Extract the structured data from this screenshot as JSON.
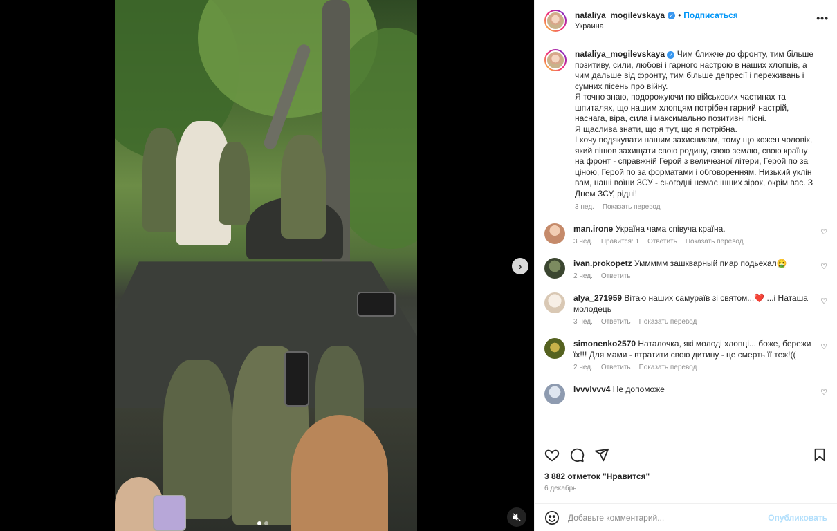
{
  "post": {
    "author": "nataliya_mogilevskaya",
    "separator": "•",
    "follow_label": "Подписаться",
    "location": "Украина",
    "more_icon": "more-horizontal-icon",
    "caption_lines": [
      "Чим ближче до фронту, тим більше",
      "позитиву, сили, любові і гарного настрою в наших хлопців, а",
      "чим дальше від фронту, тим більше депресії і переживань і",
      "сумних пісень про війну.",
      "Я точно знаю, подорожуючи по військових частинах та",
      "шпиталях, що нашим хлопцям потрібен гарний настрій,",
      "наснага, віра, сила і максимально позитивні пісні.",
      "Я щаслива знати, що я тут, що я потрібна.",
      "І хочу подякувати нашим захисникам, тому що кожен чоловік,",
      "який пішов захищати свою родину, свою землю, свою країну",
      "на фронт - справжній Герой з величезної літери, Герой по за",
      "ціною, Герой по за форматами і обговоренням. Низький уклін",
      "вам, наші воїни ЗСУ - сьогодні немає інших зірок, окрім вас. З",
      "Днем ЗСУ, рідні!"
    ],
    "caption_time": "3 нед.",
    "translate_label": "Показать перевод",
    "likes": "3 882 отметок \"Нравится\"",
    "date": "6 декабрь",
    "comment_placeholder": "Добавьте комментарий...",
    "post_label": "Опубликовать"
  },
  "comments": [
    {
      "user": "man.irone",
      "text": "Україна чама співуча країна.",
      "time": "3 нед.",
      "likes": "Нравится: 1",
      "reply": "Ответить",
      "translate": "Показать перевод",
      "avatar_color": "#c58a6a"
    },
    {
      "user": "ivan.prokopetz",
      "text": "Уммммм зашкварный пиар подьехал🤮",
      "time": "2 нед.",
      "reply": "Ответить",
      "avatar_color": "#4c5a3e"
    },
    {
      "user": "alya_271959",
      "text": "Вітаю наших самураїв зі святом...❤️ ...і Наташа молодець",
      "time": "3 нед.",
      "reply": "Ответить",
      "translate": "Показать перевод",
      "avatar_color": "#e9e1d8"
    },
    {
      "user": "simonenko2570",
      "text": "Наталочка, які молоді хлопці... боже, бережи їх!!! Для мами - втратити свою дитину - це смерть її теж!((",
      "time": "2 нед.",
      "reply": "Ответить",
      "translate": "Показать перевод",
      "avatar_color": "#6b7a2a"
    },
    {
      "user": "lvvvlvvv4",
      "text": "Не допоможе",
      "avatar_color": "#9aa7b8"
    }
  ],
  "media": {
    "next_icon": "chevron-right-icon",
    "mute_icon": "muted-speaker-icon"
  },
  "icons": {
    "like": "heart-icon",
    "comment": "comment-icon",
    "share": "send-icon",
    "save": "bookmark-icon",
    "emoji": "emoji-icon"
  }
}
